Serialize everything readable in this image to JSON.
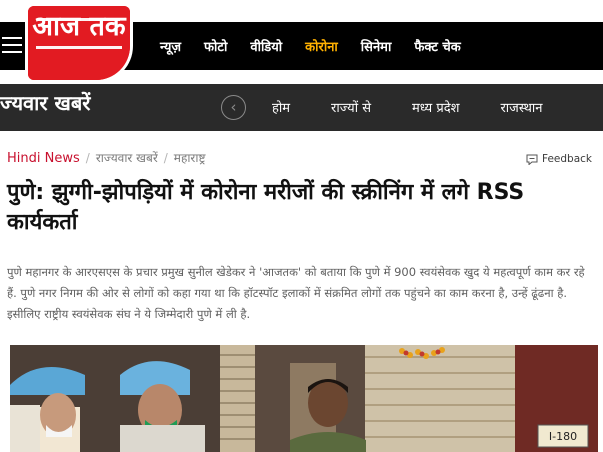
{
  "header": {
    "logo_text": "आज तक",
    "nav": [
      {
        "label": "न्यूज़",
        "active": false
      },
      {
        "label": "फोटो",
        "active": false
      },
      {
        "label": "वीडियो",
        "active": false
      },
      {
        "label": "कोरोना",
        "active": true
      },
      {
        "label": "सिनेमा",
        "active": false
      },
      {
        "label": "फैक्ट चेक",
        "active": false
      }
    ]
  },
  "state_bar": {
    "title": "ज्यवार खबरें",
    "items": [
      "होम",
      "राज्यों से",
      "मध्य प्रदेश",
      "राजस्थान"
    ]
  },
  "breadcrumb": {
    "home": "Hindi News",
    "section": "राज्यवार खबरें",
    "current": "महाराष्ट्र"
  },
  "feedback_label": "Feedback",
  "article": {
    "headline": "पुणे: झुग्गी-झोपड़ियों में कोरोना मरीजों की स्क्रीनिंग में लगे RSS कार्यकर्ता",
    "summary": "पुणे महानगर के आरएसएस के प्रचार प्रमुख सुनील खेडेकर ने 'आजतक' को बताया कि पुणे में 900 स्वयंसेवक खुद ये महत्वपूर्ण काम कर रहे हैं. पुणे नगर निगम की ओर से लोगों को कहा गया था कि हॉटस्पॉट इलाकों में संक्रमित लोगों तक पहुंचने का काम करना है, उन्हें ढूंढना है. इसीलिए राष्ट्रीय स्वयंसेवक संघ ने ये जिम्मेदारी पुणे में ली है.",
    "photo_sign": "I-180"
  },
  "colors": {
    "brand_red": "#e21b22",
    "active_nav": "#ffb100",
    "topbar": "#000000",
    "statebar": "#2a2a2a"
  }
}
